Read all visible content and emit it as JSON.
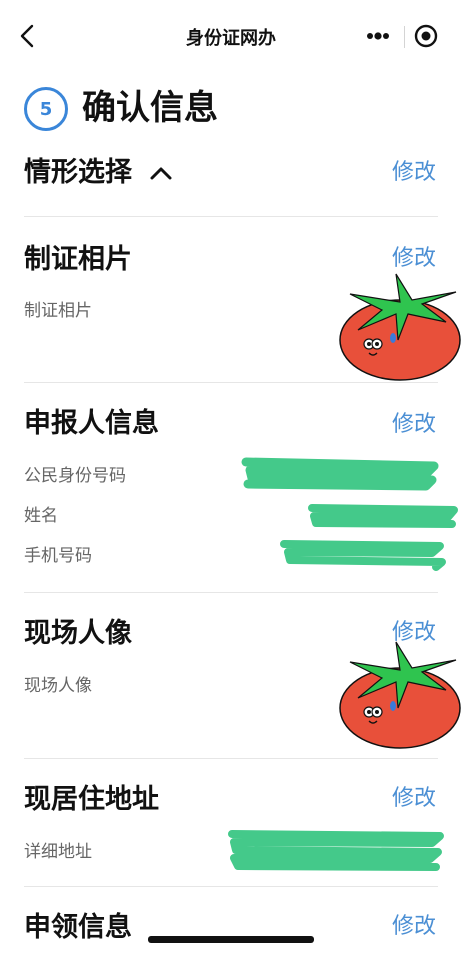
{
  "navbar": {
    "title": "身份证网办",
    "back_icon": "chevron-left-icon",
    "more_icon": "more-dots-icon",
    "close_icon": "target-close-icon"
  },
  "step": {
    "number": "5",
    "title": "确认信息",
    "accent_color": "#3a86d9"
  },
  "edit_label": "修改",
  "sections": {
    "situation": {
      "title": "情形选择"
    },
    "photo": {
      "title": "制证相片",
      "label": "制证相片"
    },
    "applicant": {
      "title": "申报人信息",
      "fields": [
        {
          "label": "公民身份号码"
        },
        {
          "label": "姓名"
        },
        {
          "label": "手机号码"
        }
      ]
    },
    "portrait": {
      "title": "现场人像",
      "label": "现场人像"
    },
    "address": {
      "title": "现居住地址",
      "field_label": "详细地址"
    },
    "receive": {
      "title": "申领信息"
    }
  },
  "colors": {
    "link": "#4b8fd4",
    "redaction": "#44c98a",
    "tomato": "#e8503a",
    "leaf": "#2fc44f"
  }
}
